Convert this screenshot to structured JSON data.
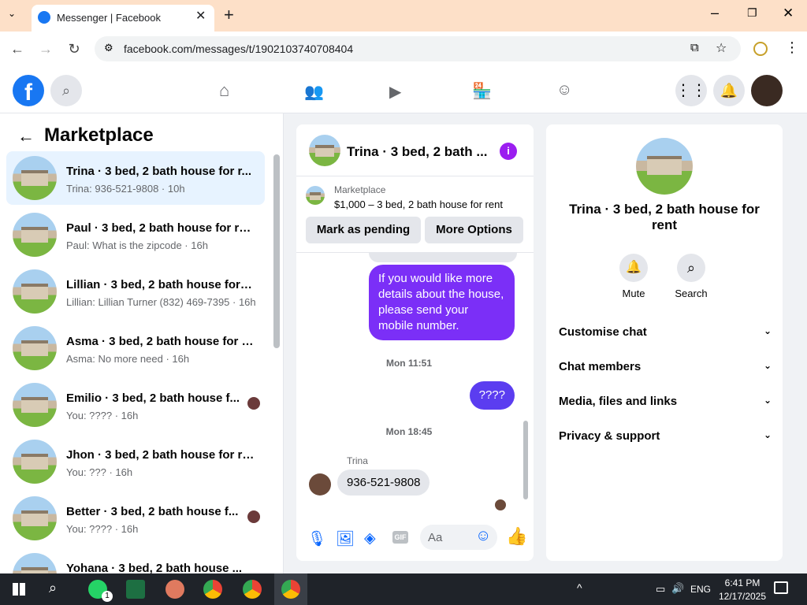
{
  "browser": {
    "tab_title": "Messenger | Facebook",
    "url": "facebook.com/messages/t/1902103740708404"
  },
  "sidebar": {
    "title": "Marketplace",
    "conversations": [
      {
        "name": "Trina · 3 bed, 2 bath house for r...",
        "preview": "Trina: 936-521-9808 · 10h"
      },
      {
        "name": "Paul · 3 bed, 2 bath house for rent",
        "preview": "Paul: What is the zipcode · 16h"
      },
      {
        "name": "Lillian · 3 bed, 2 bath house for r...",
        "preview": "Lillian: Lillian Turner (832) 469-7395 · 16h"
      },
      {
        "name": "Asma · 3 bed, 2 bath house for r...",
        "preview": "Asma: No more need · 16h"
      },
      {
        "name": "Emilio · 3 bed, 2 bath house f...",
        "preview": "You: ???? · 16h"
      },
      {
        "name": "Jhon · 3 bed, 2 bath house for re...",
        "preview": "You: ??? · 16h"
      },
      {
        "name": "Better · 3 bed, 2 bath house f...",
        "preview": "You: ???? · 16h"
      },
      {
        "name": "Yohana · 3 bed, 2 bath house ...",
        "preview": ""
      }
    ]
  },
  "chat": {
    "title": "Trina · 3 bed, 2 bath ...",
    "listing_source": "Marketplace",
    "listing": "$1,000 – 3 bed, 2 bath house for rent",
    "mark_pending": "Mark as pending",
    "more_options": "More Options",
    "msg1": "If you would like more details about the house, please send your mobile number.",
    "time1": "Mon 11:51",
    "msg2": "????",
    "time2": "Mon 18:45",
    "sender": "Trina",
    "msg3": "936-521-9808",
    "input_placeholder": "Aa"
  },
  "info": {
    "title": "Trina · 3 bed, 2 bath house for rent",
    "mute": "Mute",
    "search": "Search",
    "sections": [
      "Customise chat",
      "Chat members",
      "Media, files and links",
      "Privacy & support"
    ]
  },
  "taskbar": {
    "time": "6:41 PM",
    "date": "12/17/2025",
    "lang": "ENG",
    "whatsapp_badge": "1"
  },
  "colors": {
    "accent": "#1877f2",
    "bubble": "#7b2ff7",
    "bubble2": "#5b3df0"
  }
}
